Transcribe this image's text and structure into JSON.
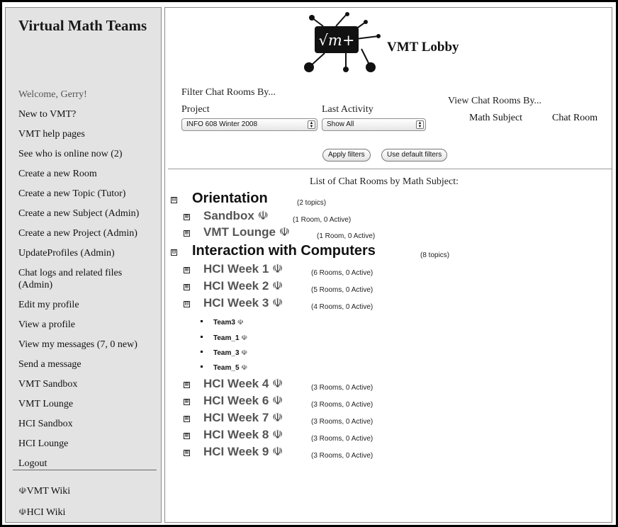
{
  "sidebar": {
    "brand": "Virtual Math Teams",
    "welcome": "Welcome, Gerry!",
    "links": [
      "New to VMT?",
      "VMT help pages",
      "See who is online now (2)",
      "Create a new Room",
      "Create a new Topic (Tutor)",
      "Create a new Subject (Admin)",
      "Create a new Project (Admin)",
      "UpdateProfiles (Admin)",
      "Chat logs and related files (Admin)",
      "Edit my profile",
      "View a profile",
      "View my messages (7, 0 new)",
      "Send a message",
      "VMT Sandbox",
      "VMT Lounge",
      "HCI Sandbox",
      "HCI Lounge",
      "Logout"
    ],
    "wikis": [
      "VMT Wiki",
      "HCI Wiki"
    ]
  },
  "header": {
    "logo_text": "√m+",
    "title": "VMT Lobby"
  },
  "filters": {
    "title": "Filter Chat Rooms By...",
    "project_label": "Project",
    "project_value": "INFO 608 Winter 2008",
    "activity_label": "Last Activity",
    "activity_value": "Show All",
    "apply_label": "Apply filters",
    "default_label": "Use default filters"
  },
  "view": {
    "title": "View Chat Rooms By...",
    "subject": "Math Subject",
    "room": "Chat Room"
  },
  "list": {
    "caption": "List of Chat Rooms by Math Subject:",
    "subjects": [
      {
        "name": "Orientation",
        "count": "(2 topics)",
        "topics": [
          {
            "name": "Sandbox",
            "count": "(1 Room, 0 Active)"
          },
          {
            "name": "VMT Lounge",
            "count": "(1 Room, 0 Active)"
          }
        ]
      },
      {
        "name": "Interaction with Computers",
        "count": "(8 topics)",
        "topics": [
          {
            "name": "HCI Week 1",
            "count": "(6 Rooms, 0 Active)"
          },
          {
            "name": "HCI Week 2",
            "count": "(5 Rooms, 0 Active)"
          },
          {
            "name": "HCI Week 3",
            "count": "(4 Rooms, 0 Active)",
            "rooms": [
              "Team3",
              "Team_1",
              "Team_3",
              "Team_5"
            ]
          },
          {
            "name": "HCI Week 4",
            "count": "(3 Rooms, 0 Active)"
          },
          {
            "name": "HCI Week 6",
            "count": "(3 Rooms, 0 Active)"
          },
          {
            "name": "HCI Week 7",
            "count": "(3 Rooms, 0 Active)"
          },
          {
            "name": "HCI Week 8",
            "count": "(3 Rooms, 0 Active)"
          },
          {
            "name": "HCI Week 9",
            "count": "(3 Rooms, 0 Active)"
          }
        ]
      }
    ]
  },
  "icons": {
    "collapse": "⊟",
    "expand": "⊞",
    "people": "☫"
  }
}
